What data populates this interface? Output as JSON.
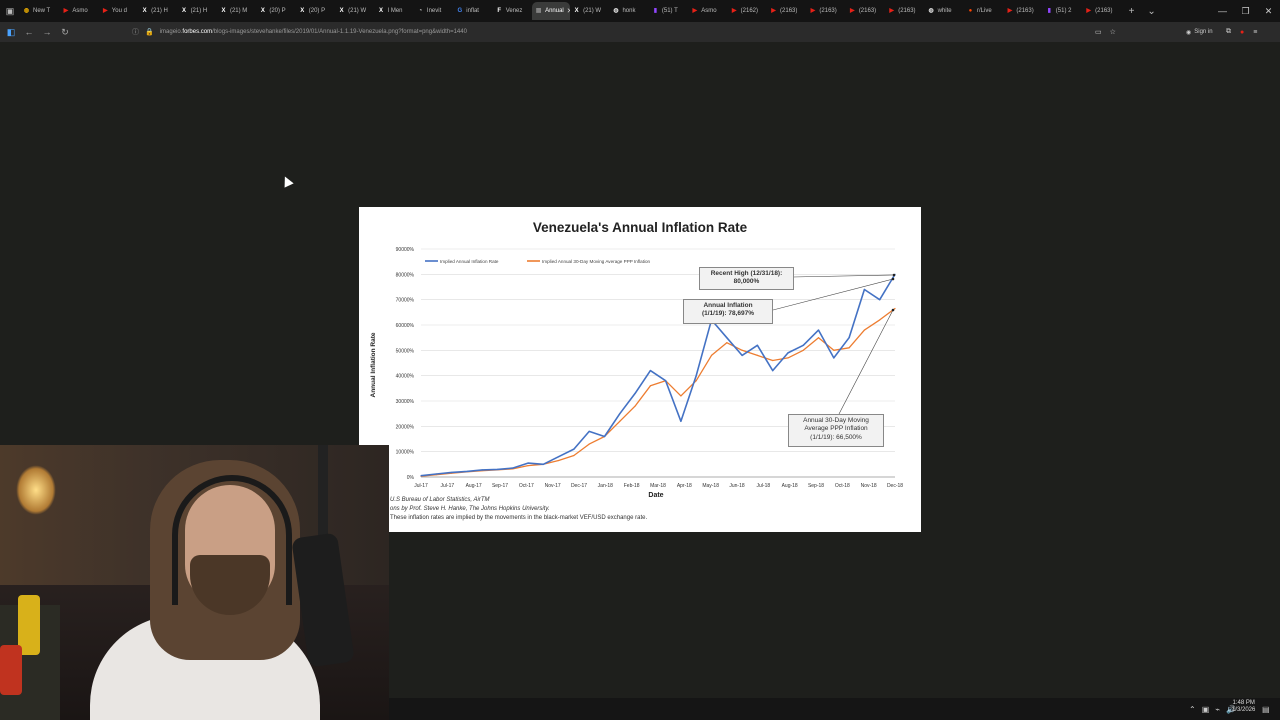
{
  "browser": {
    "tabs": [
      {
        "label": "New T",
        "icon": "globe-icon",
        "color": "#f5b400"
      },
      {
        "label": "Asmo",
        "icon": "youtube-icon",
        "color": "#e62117"
      },
      {
        "label": "You d",
        "icon": "youtube-icon",
        "color": "#e62117"
      },
      {
        "label": "(21) H",
        "icon": "x-icon",
        "color": "#ffffff"
      },
      {
        "label": "(21) H",
        "icon": "x-icon",
        "color": "#ffffff"
      },
      {
        "label": "(21) M",
        "icon": "x-icon",
        "color": "#ffffff"
      },
      {
        "label": "(20) P",
        "icon": "x-icon",
        "color": "#ffffff"
      },
      {
        "label": "(20) P",
        "icon": "x-icon",
        "color": "#ffffff"
      },
      {
        "label": "(21) W",
        "icon": "x-icon",
        "color": "#ffffff"
      },
      {
        "label": "I Men",
        "icon": "x-icon",
        "color": "#ffffff"
      },
      {
        "label": "Inevit",
        "icon": "clock-icon",
        "color": "#cccccc"
      },
      {
        "label": "inflat",
        "icon": "google-icon",
        "color": "#4285f4"
      },
      {
        "label": "Venez",
        "icon": "forbes-icon",
        "color": "#ffffff"
      },
      {
        "label": "Annual",
        "icon": "image-icon",
        "color": "#888888",
        "active": true
      },
      {
        "label": "(21) W",
        "icon": "x-icon",
        "color": "#ffffff"
      },
      {
        "label": "honk",
        "icon": "globe-icon",
        "color": "#dddddd"
      },
      {
        "label": "(51) T",
        "icon": "twitch-icon",
        "color": "#9146ff"
      },
      {
        "label": "Asmo",
        "icon": "youtube-icon",
        "color": "#e62117"
      },
      {
        "label": "(2162)",
        "icon": "youtube-icon",
        "color": "#e62117"
      },
      {
        "label": "(2163)",
        "icon": "youtube-icon",
        "color": "#e62117"
      },
      {
        "label": "(2163)",
        "icon": "youtube-icon",
        "color": "#e62117"
      },
      {
        "label": "(2163)",
        "icon": "youtube-icon",
        "color": "#e62117"
      },
      {
        "label": "(2163)",
        "icon": "youtube-icon",
        "color": "#e62117"
      },
      {
        "label": "white",
        "icon": "globe-icon",
        "color": "#dddddd"
      },
      {
        "label": "r/Live",
        "icon": "reddit-icon",
        "color": "#ff4500"
      },
      {
        "label": "(2163)",
        "icon": "youtube-icon",
        "color": "#e62117"
      },
      {
        "label": "(51) 2",
        "icon": "twitch-icon",
        "color": "#9146ff"
      },
      {
        "label": "(2163)",
        "icon": "youtube-icon",
        "color": "#e62117"
      }
    ],
    "url_prefix": "imageio.",
    "url_host": "forbes.com",
    "url_path": "/blogs-images/stevehanke/files/2019/01/Annual-1.1.19-Venezuela.png?format=png&width=1440",
    "signin_label": "Sign in"
  },
  "figure": {
    "title": "Venezuela's Annual Inflation Rate",
    "source_lines": [
      "U.S Bureau of Labor Statistics, AirTM",
      "ons by Prof. Steve H. Hanke, The Johns Hopkins University.",
      "These inflation rates are implied by the movements in the black-market VEF/USD exchange rate."
    ],
    "annotations": [
      {
        "id": "recent-high",
        "line1": "Recent High (12/31/18):",
        "line2": "80,000%"
      },
      {
        "id": "annual-inflation",
        "line1": "Annual Inflation",
        "line2": "(1/1/19): 78,697%"
      },
      {
        "id": "moving-average",
        "line1": "Annual 30-Day Moving",
        "line2": "Average PPP Inflation",
        "line3": "(1/1/19): 66,500%"
      }
    ]
  },
  "chart_data": {
    "type": "line",
    "title": "Venezuela's Annual Inflation Rate",
    "xlabel": "Date",
    "ylabel": "Annual Inflation Rate",
    "ylim": [
      0,
      90000
    ],
    "y_ticks": [
      "0%",
      "10000%",
      "20000%",
      "30000%",
      "40000%",
      "50000%",
      "60000%",
      "70000%",
      "80000%",
      "90000%"
    ],
    "x_ticks": [
      "Jul-17",
      "Jul-17",
      "Aug-17",
      "Sep-17",
      "Oct-17",
      "Nov-17",
      "Dec-17",
      "Jan-18",
      "Feb-18",
      "Mar-18",
      "Apr-18",
      "May-18",
      "Jun-18",
      "Jul-18",
      "Aug-18",
      "Sep-18",
      "Oct-18",
      "Nov-18",
      "Dec-18"
    ],
    "grid": true,
    "legend_position": "top-left",
    "x": [
      "Jul-17",
      "Jul-17",
      "Aug-17",
      "Sep-17",
      "Oct-17",
      "Nov-17",
      "Dec-17",
      "Jan-18",
      "Feb-18",
      "Mar-18",
      "Mar-18",
      "Apr-18",
      "Apr-18",
      "May-18",
      "May-18",
      "Jun-18",
      "Jun-18",
      "Jul-18",
      "Jul-18",
      "Jul-18",
      "Aug-18",
      "Aug-18",
      "Aug-18",
      "Sep-18",
      "Sep-18",
      "Oct-18",
      "Oct-18",
      "Nov-18",
      "Nov-18",
      "Dec-18",
      "Dec-18",
      "Dec-18"
    ],
    "series": [
      {
        "name": "Implied Annual Inflation Rate",
        "color": "#4472c4",
        "values": [
          500,
          1200,
          1800,
          2200,
          2800,
          3000,
          3500,
          5500,
          5000,
          8000,
          11000,
          18000,
          16000,
          25000,
          33000,
          42000,
          38000,
          22000,
          40000,
          62000,
          55000,
          48000,
          52000,
          42000,
          49000,
          52000,
          58000,
          47000,
          55000,
          74000,
          70000,
          80000
        ]
      },
      {
        "name": "Implied Annual 30-Day Moving Average PPP Inflation",
        "color": "#ed7d31",
        "values": [
          300,
          900,
          1500,
          2000,
          2500,
          2800,
          3200,
          4500,
          5000,
          6500,
          8500,
          13000,
          16000,
          22000,
          28000,
          36000,
          38000,
          32000,
          38000,
          48000,
          53000,
          50000,
          48000,
          46000,
          47000,
          50000,
          55000,
          50000,
          51000,
          58000,
          62000,
          66500
        ]
      }
    ]
  }
}
